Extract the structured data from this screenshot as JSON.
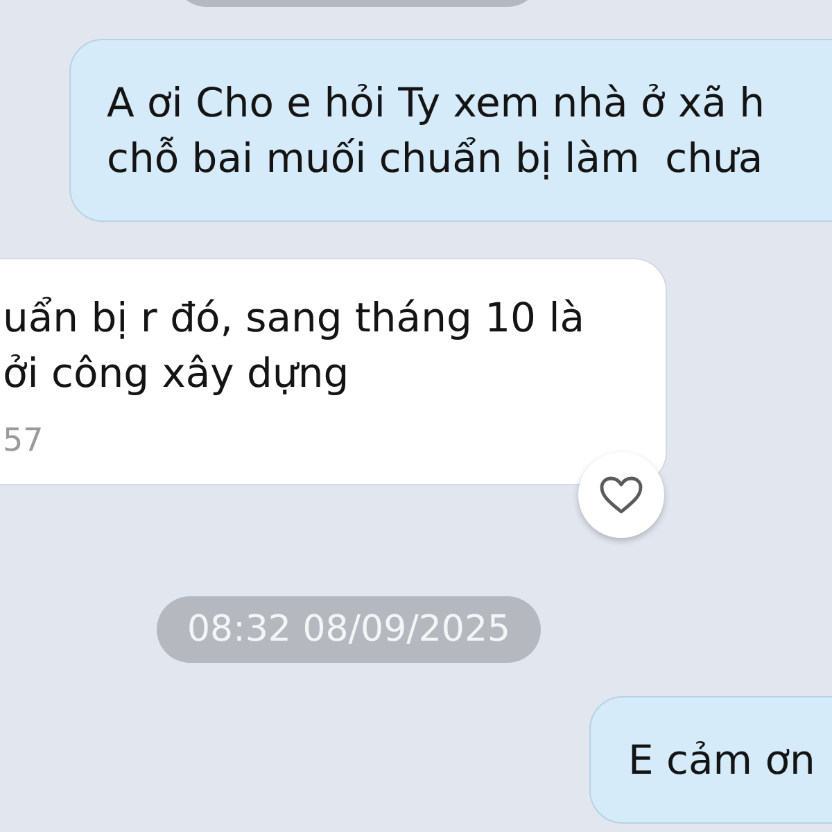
{
  "messages": [
    {
      "kind": "date_partial"
    },
    {
      "kind": "sent",
      "text": "A ơi Cho e hỏi Ty xem nhà ở xã h\nchỗ bai muối chuẩn bị làm  chưa"
    },
    {
      "kind": "received",
      "text": "uẩn bị r đó, sang tháng 10 là\nởi công xây dựng",
      "time": "57",
      "reacted": false
    },
    {
      "kind": "date",
      "text": "08:32 08/09/2025"
    },
    {
      "kind": "sent_short",
      "text": "E cảm ơn"
    }
  ]
}
